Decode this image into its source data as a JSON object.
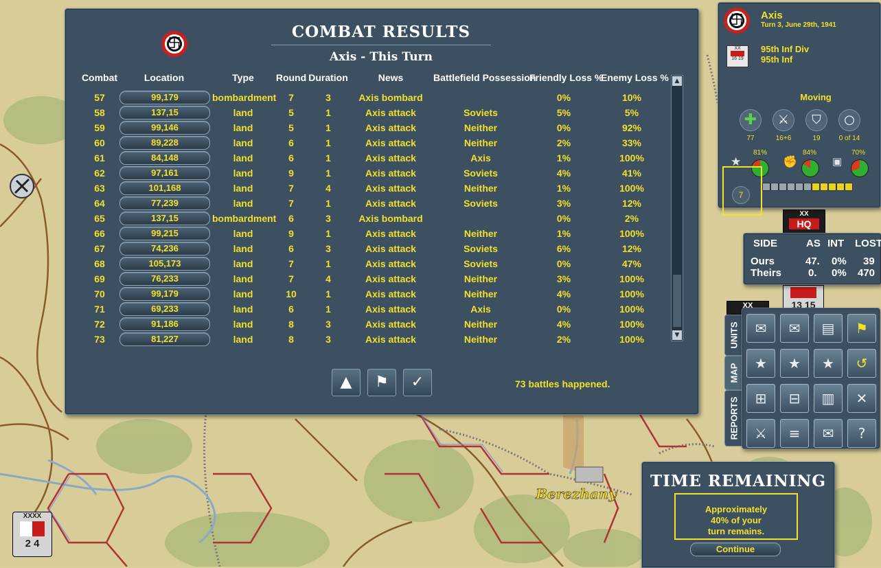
{
  "combat": {
    "title": "COMBAT RESULTS",
    "subtitle": "Axis - This Turn",
    "headers": [
      "Combat",
      "Location",
      "Type",
      "Round",
      "Duration",
      "News",
      "Battlefield Possession",
      "Friendly Loss %",
      "Enemy Loss %"
    ],
    "rows": [
      [
        "57",
        "99,179",
        "bombardment",
        "7",
        "3",
        "Axis bombard",
        "",
        "0%",
        "10%"
      ],
      [
        "58",
        "137,15",
        "land",
        "5",
        "1",
        "Axis attack",
        "Soviets",
        "5%",
        "5%"
      ],
      [
        "59",
        "99,146",
        "land",
        "5",
        "1",
        "Axis attack",
        "Neither",
        "0%",
        "92%"
      ],
      [
        "60",
        "89,228",
        "land",
        "6",
        "1",
        "Axis attack",
        "Neither",
        "2%",
        "33%"
      ],
      [
        "61",
        "84,148",
        "land",
        "6",
        "1",
        "Axis attack",
        "Axis",
        "1%",
        "100%"
      ],
      [
        "62",
        "97,161",
        "land",
        "9",
        "1",
        "Axis attack",
        "Soviets",
        "4%",
        "41%"
      ],
      [
        "63",
        "101,168",
        "land",
        "7",
        "4",
        "Axis attack",
        "Neither",
        "1%",
        "100%"
      ],
      [
        "64",
        "77,239",
        "land",
        "7",
        "1",
        "Axis attack",
        "Soviets",
        "3%",
        "12%"
      ],
      [
        "65",
        "137,15",
        "bombardment",
        "6",
        "3",
        "Axis bombard",
        "",
        "0%",
        "2%"
      ],
      [
        "66",
        "99,215",
        "land",
        "9",
        "1",
        "Axis attack",
        "Neither",
        "1%",
        "100%"
      ],
      [
        "67",
        "74,236",
        "land",
        "6",
        "3",
        "Axis attack",
        "Soviets",
        "6%",
        "12%"
      ],
      [
        "68",
        "105,173",
        "land",
        "7",
        "1",
        "Axis attack",
        "Soviets",
        "0%",
        "47%"
      ],
      [
        "69",
        "76,233",
        "land",
        "7",
        "4",
        "Axis attack",
        "Neither",
        "3%",
        "100%"
      ],
      [
        "70",
        "99,179",
        "land",
        "10",
        "1",
        "Axis attack",
        "Neither",
        "4%",
        "100%"
      ],
      [
        "71",
        "69,233",
        "land",
        "6",
        "1",
        "Axis attack",
        "Axis",
        "0%",
        "100%"
      ],
      [
        "72",
        "91,186",
        "land",
        "8",
        "3",
        "Axis attack",
        "Neither",
        "4%",
        "100%"
      ],
      [
        "73",
        "81,227",
        "land",
        "8",
        "3",
        "Axis attack",
        "Neither",
        "2%",
        "100%"
      ]
    ],
    "battles_text": "73 battles happened."
  },
  "unit_panel": {
    "side": "Axis",
    "turn": "Turn 3, June 29th, 1941",
    "unit_line1": "95th Inf Div",
    "unit_line2": "95th Inf",
    "counter_top": "XX",
    "counter_bottom": "16 19",
    "status": "Moving",
    "stats": [
      "77",
      "16+6",
      "19",
      "0 of 14"
    ],
    "pcts": [
      "81%",
      "84%",
      "70%"
    ],
    "level": "7",
    "pips_filled": 5,
    "pips_total": 11
  },
  "side_table": {
    "headers": [
      "SIDE",
      "AS",
      "INT",
      "LOST"
    ],
    "rows": [
      [
        "Ours",
        "47.",
        "0%",
        "39"
      ],
      [
        "Theirs",
        "0.",
        "0%",
        "470"
      ]
    ]
  },
  "tabs": [
    "UNITS",
    "MAP",
    "REPORTS"
  ],
  "time_remaining": {
    "title": "TIME REMAINING",
    "line1": "Approximately",
    "line2": "40% of your",
    "line3": "turn remains.",
    "continue_label": "Continue"
  },
  "map": {
    "city_name": "Berezhany",
    "counter_hq": "HQ",
    "counter_xx": "XX",
    "counter_1315": "13 15",
    "counter_xxxx": "XXXX",
    "counter_24": "2 4"
  }
}
